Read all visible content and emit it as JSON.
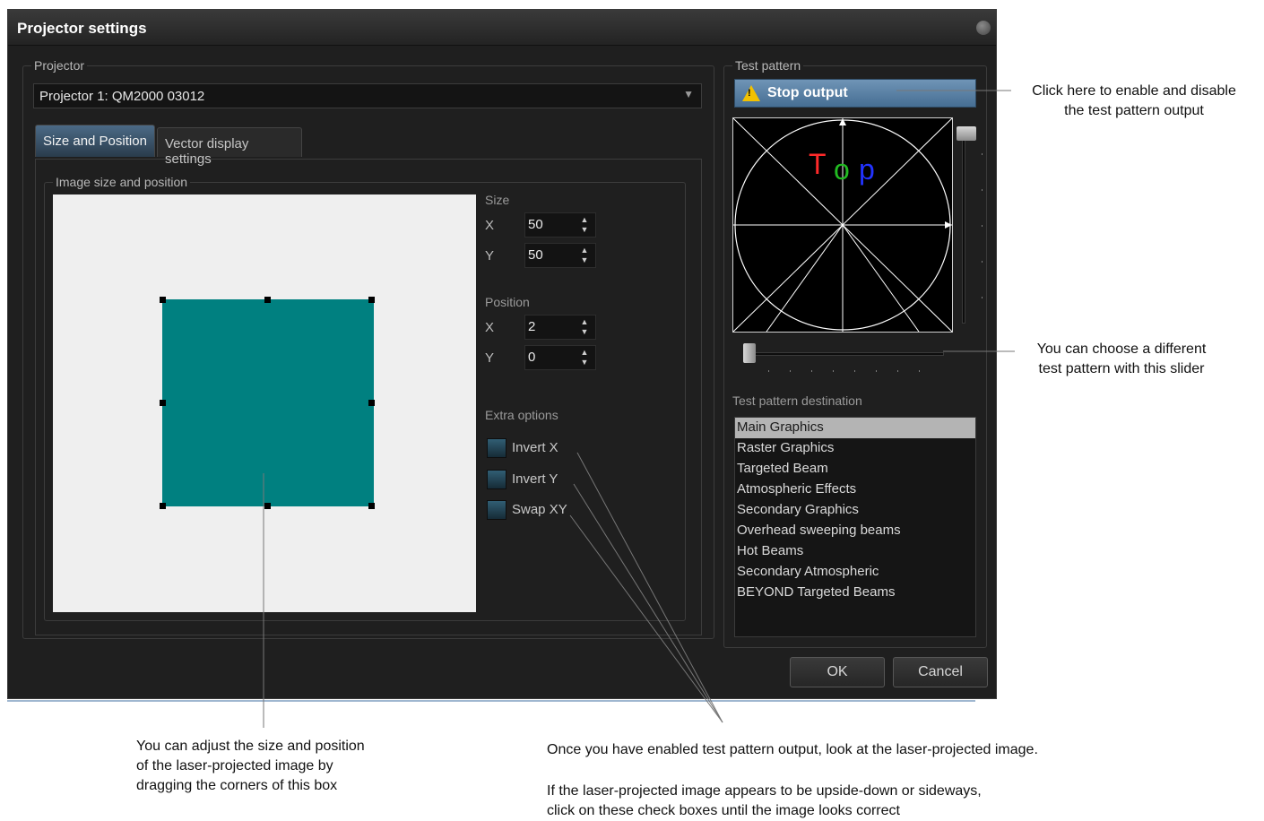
{
  "dialog": {
    "title": "Projector settings",
    "projector": {
      "legend": "Projector",
      "selected": "Projector 1: QM2000 03012"
    },
    "tabs": [
      {
        "label": "Size and Position"
      },
      {
        "label": "Vector display settings"
      }
    ],
    "image_group": {
      "legend": "Image size and position",
      "size_label": "Size",
      "size_x_label": "X",
      "size_x": "50",
      "size_y_label": "Y",
      "size_y": "50",
      "position_label": "Position",
      "pos_x_label": "X",
      "pos_x": "2",
      "pos_y_label": "Y",
      "pos_y": "0",
      "extra_label": "Extra options",
      "options": [
        "Invert X",
        "Invert Y",
        "Swap XY"
      ]
    },
    "test_pattern": {
      "legend": "Test pattern",
      "stop_label": "Stop output",
      "preview_text": [
        "T",
        "o",
        "p"
      ],
      "destination_label": "Test pattern destination",
      "destinations": [
        "Main Graphics",
        "Raster Graphics",
        "Targeted Beam",
        "Atmospheric Effects",
        "Secondary Graphics",
        "Overhead sweeping beams",
        "Hot Beams",
        "Secondary Atmospheric",
        "BEYOND Targeted Beams"
      ]
    },
    "ok_label": "OK",
    "cancel_label": "Cancel"
  },
  "annotations": {
    "stop_note": [
      "Click here to enable and disable",
      "the test pattern output"
    ],
    "slider_note": [
      "You can choose a different",
      "test pattern with this slider"
    ],
    "box_note": [
      "You can adjust the size and position",
      "of the laser-projected image by",
      "dragging the corners of this box"
    ],
    "check_note_1": "Once you have enabled test pattern output, look at the laser-projected image.",
    "check_note_2": [
      "If the laser-projected image appears to be upside-down or sideways,",
      "click on these check boxes until the image looks correct"
    ]
  },
  "colors": {
    "dialog_bg": "#1f1f1f",
    "accent": "#466e93",
    "teal": "#008080"
  }
}
